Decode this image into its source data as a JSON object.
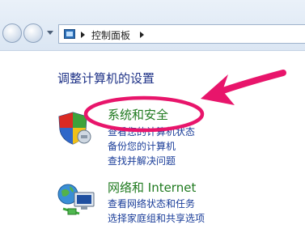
{
  "address": {
    "breadcrumb": "控制面板"
  },
  "main": {
    "heading": "调整计算机的设置",
    "categories": [
      {
        "title": "系统和安全",
        "links": [
          "查看您的计算机状态",
          "备份您的计算机",
          "查找并解决问题"
        ]
      },
      {
        "title": "网络和 Internet",
        "links": [
          "查看网络状态和任务",
          "选择家庭组和共享选项"
        ]
      }
    ]
  },
  "annotation": {
    "highlight_color": "#e8156b"
  }
}
